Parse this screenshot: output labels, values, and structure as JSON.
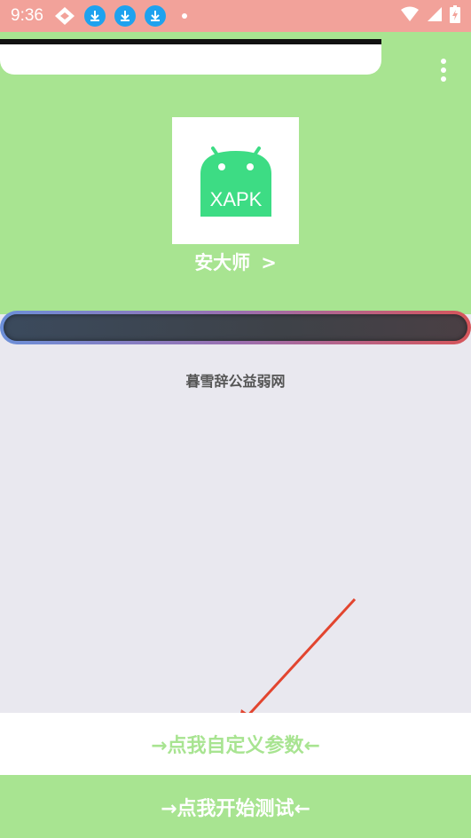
{
  "status_bar": {
    "time": "9:36",
    "left_icons": [
      "diamond-icon",
      "download-icon",
      "download-icon",
      "download-icon",
      "dot-icon"
    ],
    "right_icons": [
      "wifi-icon",
      "signal-icon",
      "battery-icon"
    ]
  },
  "header": {
    "background": "#a8e491",
    "app_icon_text": "XAPK",
    "app_icon_color": "#3ddc84",
    "app_name": "安大师",
    "app_name_chevron": ">"
  },
  "progress": {
    "gradient_start": "#6c8fd8",
    "gradient_end": "#d6555a"
  },
  "content": {
    "site_name": "暮雪辞公益弱网",
    "arrow_color": "#e2452f"
  },
  "buttons": {
    "custom_params": "→点我自定义参数←",
    "start_test": "→点我开始测试←"
  }
}
